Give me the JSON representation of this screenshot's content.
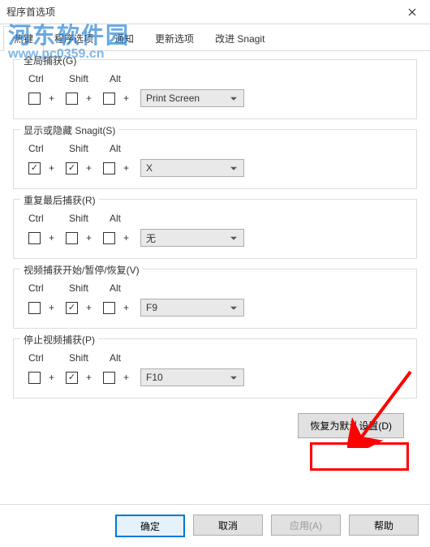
{
  "window": {
    "title": "程序首选项"
  },
  "watermark": {
    "cn": "河东软件园",
    "url": "www.pc0359.cn"
  },
  "tabs": [
    {
      "label": "热键",
      "active": true
    },
    {
      "label": "程序选项",
      "active": false
    },
    {
      "label": "通知",
      "active": false
    },
    {
      "label": "更新选项",
      "active": false
    },
    {
      "label": "改进 Snagit",
      "active": false
    }
  ],
  "modifiers": {
    "ctrl": "Ctrl",
    "shift": "Shift",
    "alt": "Alt",
    "plus": "+"
  },
  "sections": [
    {
      "legend": "全局捕获(G)",
      "ctrl": false,
      "shift": false,
      "alt": false,
      "key": "Print Screen"
    },
    {
      "legend": "显示或隐藏 Snagit(S)",
      "ctrl": true,
      "shift": true,
      "alt": false,
      "key": "X"
    },
    {
      "legend": "重复最后捕获(R)",
      "ctrl": false,
      "shift": false,
      "alt": false,
      "key": "无"
    },
    {
      "legend": "视频捕获开始/暂停/恢复(V)",
      "ctrl": false,
      "shift": true,
      "alt": false,
      "key": "F9"
    },
    {
      "legend": "停止视频捕获(P)",
      "ctrl": false,
      "shift": true,
      "alt": false,
      "key": "F10"
    }
  ],
  "restore": "恢复为默认设置(D)",
  "buttons": {
    "ok": "确定",
    "cancel": "取消",
    "apply": "应用(A)",
    "help": "帮助"
  }
}
